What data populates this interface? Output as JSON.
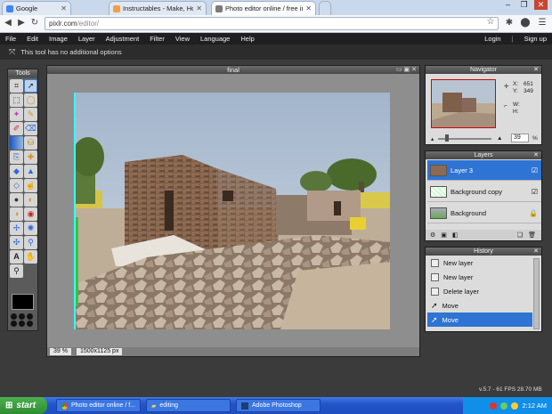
{
  "browser": {
    "tabs": [
      {
        "label": "Google",
        "color": "#4285f4"
      },
      {
        "label": "Instructables - Make, How To",
        "color": "#f0a040"
      },
      {
        "label": "Photo editor online / free ima",
        "color": "#7a7a7a"
      }
    ],
    "url_host": "pixlr.com",
    "url_path": "/editor/"
  },
  "menu": {
    "items": [
      "File",
      "Edit",
      "Image",
      "Layer",
      "Adjustment",
      "Filter",
      "View",
      "Language",
      "Help"
    ],
    "login": "Login",
    "signup": "Sign up"
  },
  "options_bar": {
    "message": "This tool has no additional options"
  },
  "tools_panel": {
    "title": "Tools"
  },
  "document": {
    "title": "final",
    "zoom": "39",
    "zoom_unit": "%",
    "dimensions": "1500x1125 px"
  },
  "navigator": {
    "title": "Navigator",
    "x_label": "X:",
    "x_value": "651",
    "y_label": "Y:",
    "y_value": "349",
    "w_label": "W:",
    "h_label": "H:",
    "zoom": "39",
    "zoom_unit": "%"
  },
  "layers_panel": {
    "title": "Layers",
    "items": [
      {
        "name": "Layer 3",
        "selected": true
      },
      {
        "name": "Background copy",
        "selected": false
      },
      {
        "name": "Background",
        "selected": false
      }
    ]
  },
  "history_panel": {
    "title": "History",
    "items": [
      "New layer",
      "New layer",
      "Delete layer",
      "Move",
      "Move"
    ]
  },
  "status": {
    "fps": "v.5.7 - 61 FPS 28.70 MB"
  },
  "taskbar": {
    "start": "start",
    "tasks": [
      "Photo editor online / f...",
      "editing",
      "Adobe Photoshop"
    ],
    "clock": "2:12 AM"
  },
  "colors": {
    "selection": "#2f74d3",
    "taskbar": "#2355c8",
    "start": "#2f8b32"
  }
}
